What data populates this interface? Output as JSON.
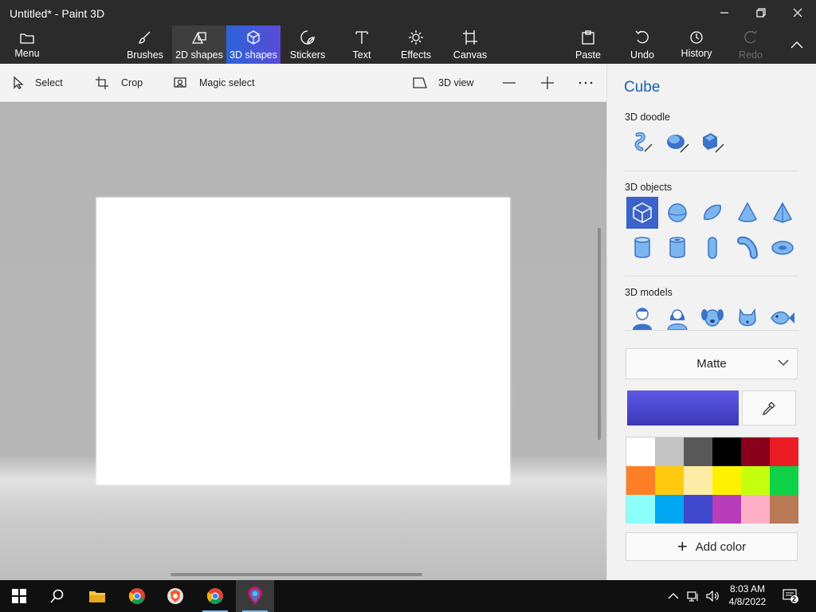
{
  "window": {
    "title": "Untitled* - Paint 3D",
    "controls": [
      "minimize",
      "restore",
      "close"
    ]
  },
  "ribbon": {
    "menu_label": "Menu",
    "tabs": [
      {
        "label": "Brushes",
        "icon": "brush-icon"
      },
      {
        "label": "2D shapes",
        "icon": "2d-shapes-icon"
      },
      {
        "label": "3D shapes",
        "icon": "3d-cube-icon",
        "selected": true
      },
      {
        "label": "Stickers",
        "icon": "sticker-icon"
      },
      {
        "label": "Text",
        "icon": "text-icon"
      },
      {
        "label": "Effects",
        "icon": "effects-icon"
      },
      {
        "label": "Canvas",
        "icon": "canvas-icon"
      }
    ],
    "actions": [
      {
        "label": "Paste",
        "icon": "paste-icon"
      },
      {
        "label": "Undo",
        "icon": "undo-icon"
      },
      {
        "label": "History",
        "icon": "history-icon"
      },
      {
        "label": "Redo",
        "icon": "redo-icon",
        "disabled": true
      }
    ]
  },
  "toolbar": {
    "select_label": "Select",
    "crop_label": "Crop",
    "magic_select_label": "Magic select",
    "view_3d_label": "3D view"
  },
  "panel": {
    "title": "Cube",
    "doodle_heading": "3D doodle",
    "doodle_tools": [
      "sharp-edge-doodle-icon",
      "soft-edge-doodle-icon",
      "tube-doodle-icon"
    ],
    "objects_heading": "3D objects",
    "objects": [
      "cube-icon",
      "sphere-icon",
      "hemisphere-icon",
      "cone-icon",
      "pyramid-icon",
      "cylinder-icon",
      "tube-icon",
      "capsule-icon",
      "bent-tube-icon",
      "donut-icon"
    ],
    "models_heading": "3D models",
    "models": [
      "man-model-icon",
      "woman-model-icon",
      "dog-model-icon",
      "cat-model-icon",
      "fish-model-icon"
    ],
    "finish_value": "Matte",
    "current_color": "#4a48d0",
    "palette": [
      "#ffffff",
      "#c3c3c3",
      "#585858",
      "#000000",
      "#88001b",
      "#ec1c24",
      "#ff7f27",
      "#ffc90e",
      "#fdeca6",
      "#fff200",
      "#c4ff0e",
      "#0ed145",
      "#8cfffb",
      "#00a8f3",
      "#3f48cc",
      "#b83dba",
      "#ffaec8",
      "#b97a56"
    ],
    "add_color_label": "Add color"
  },
  "taskbar": {
    "apps": [
      "windows-start-icon",
      "search-icon",
      "file-explorer-icon",
      "chrome-icon",
      "brave-icon",
      "chrome-icon",
      "paint-3d-icon"
    ],
    "time": "8:03 AM",
    "date": "4/8/2022",
    "notification_count": "2"
  }
}
